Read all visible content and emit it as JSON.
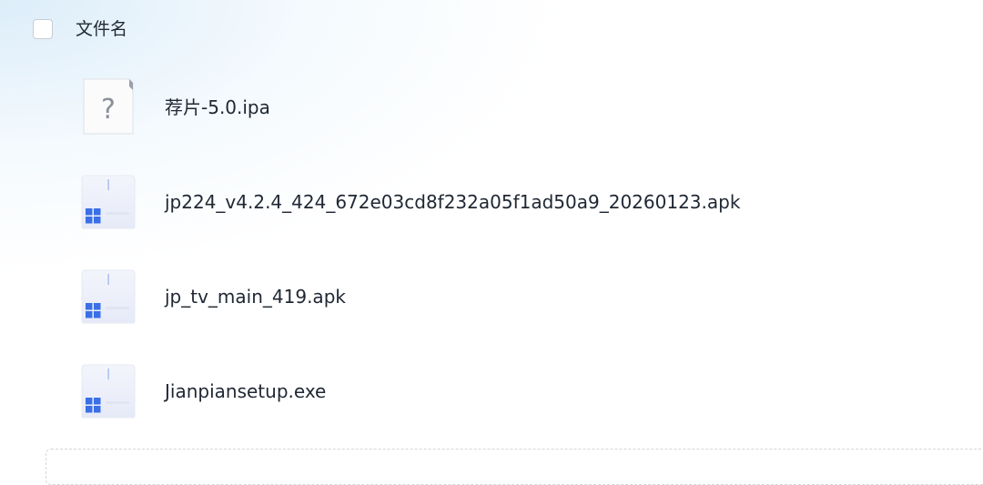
{
  "header": {
    "column_label": "文件名"
  },
  "files": [
    {
      "name": "荐片-5.0.ipa",
      "icon": "unknown-file-icon"
    },
    {
      "name": "jp224_v4.2.4_424_672e03cd8f232a05f1ad50a9_20260123.apk",
      "icon": "windows-app-file-icon"
    },
    {
      "name": "jp_tv_main_419.apk",
      "icon": "windows-app-file-icon"
    },
    {
      "name": "Jianpiansetup.exe",
      "icon": "windows-app-file-icon"
    }
  ],
  "colors": {
    "accent_blue": "#3a6fe6",
    "text": "#1f2733",
    "background_tint": "#d6eaf8"
  }
}
